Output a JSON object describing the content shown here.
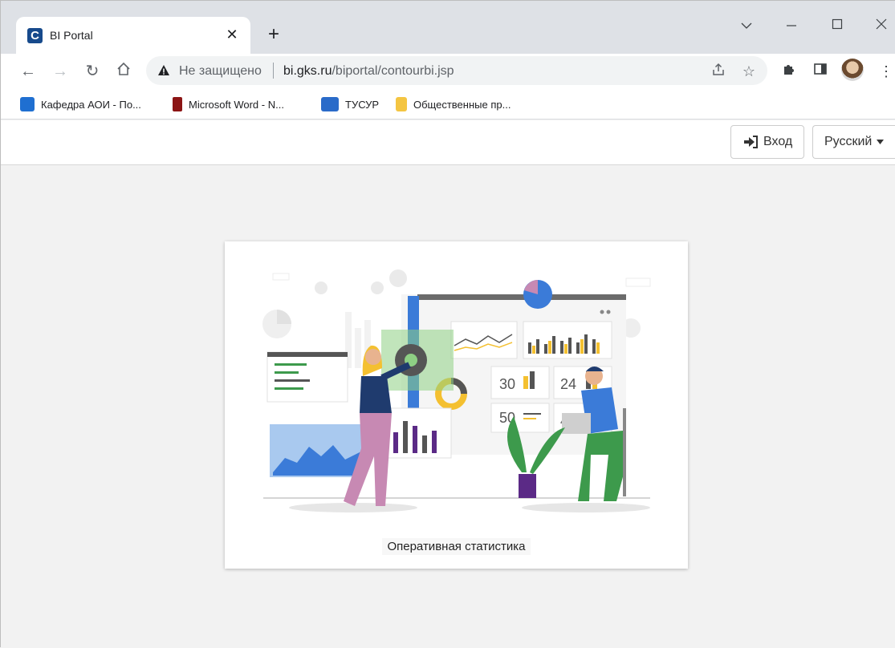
{
  "browser": {
    "tab_title": "BI Portal",
    "favicon_letter": "C",
    "security_label": "Не защищено",
    "url_host": "bi.gks.ru",
    "url_path": "/biportal/contourbi.jsp",
    "bookmarks": [
      {
        "label": "Кафедра АОИ - По...",
        "icon": "trello-icon",
        "color": "#1f6fd1"
      },
      {
        "label": "Microsoft Word - N...",
        "icon": "stanford-icon",
        "color": "#8c1515"
      },
      {
        "label": "ТУСУР",
        "icon": "tusur-icon",
        "color": "#2a6bc9"
      },
      {
        "label": "Общественные пр...",
        "icon": "folder-icon",
        "color": "#f4c542"
      }
    ]
  },
  "page": {
    "login_label": "Вход",
    "language_label": "Русский",
    "card_caption": "Оперативная статистика",
    "dashboard_numbers": [
      "30",
      "24",
      "50",
      "42"
    ]
  },
  "colors": {
    "accent_blue": "#3b7bd8",
    "accent_yellow": "#f4c030",
    "accent_purple": "#5b2a86",
    "accent_green": "#3d9a4c"
  }
}
